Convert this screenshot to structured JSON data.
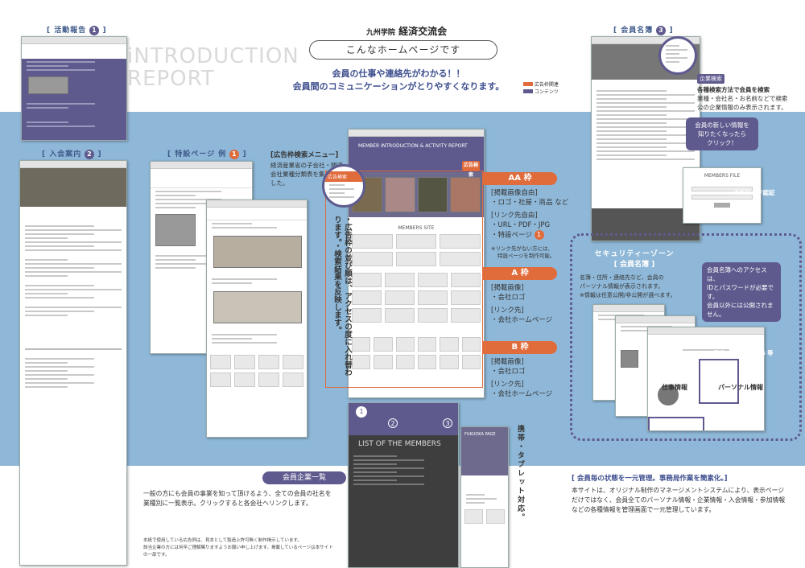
{
  "header": {
    "kicker": "九州学院",
    "title": "経済交流会",
    "pill": "こんなホームページです",
    "lead1": "会員の仕事や連絡先がわかる！！",
    "lead2": "会員間のコミュニケーションがとりやすくなります。",
    "legend": [
      {
        "label": "広告枠関連",
        "color": "#e06b3b"
      },
      {
        "label": "コンテンツ",
        "color": "#5e5a8e"
      }
    ]
  },
  "watermark": {
    "line1": "iNTRODUCTION",
    "line2": "REPORT"
  },
  "sections": {
    "activity": {
      "label": "[ 活動報告",
      "num": "1",
      "close": "]"
    },
    "join": {
      "label": "[ 入会案内",
      "num": "2",
      "close": "]"
    },
    "special": {
      "label": "[ 特設ページ 例",
      "num": "1",
      "close": "]"
    },
    "members": {
      "label": "[ 会員名簿",
      "num": "3",
      "close": "]"
    },
    "adsearch": {
      "title": "[広告枠検索メニュー]",
      "desc": "経済産業省の子会社・関連会社業種分類表を集約しました。"
    }
  },
  "center": {
    "hero": "MEMBER INTRODUCTION & ACTIVITY REPORT",
    "adtab": "広告検索",
    "membersLabel": "MEMBERS SITE",
    "vertical": "・広告枠の並び順は、アクセスの度に入れ替わります。・検索結果を反映します。",
    "listTitle": "LIST OF THE MEMBERS",
    "fukuoka": "FUKUOKA PAGE",
    "arrow": "2",
    "arrow3": "3",
    "arrow1": "1"
  },
  "ads": {
    "aa": {
      "label": "AA 枠",
      "l1": "[掲載画像自由]",
      "l2": "・ロゴ・社屋・商品 など",
      "l3": "[リンク先自由]",
      "l4": "・URL・PDF・JPG",
      "l5": "・特設ページ",
      "l5num": "1",
      "note1": "※リンク先がない方には、",
      "note2": "特設ページを制作可能。"
    },
    "a": {
      "label": "A 枠",
      "l1": "[掲載画像]",
      "l2": "・会社ロゴ",
      "l3": "[リンク先]",
      "l4": "・会社ホームページ"
    },
    "b": {
      "label": "B 枠",
      "l1": "[掲載画像]",
      "l2": "・会社ロゴ",
      "l3": "[リンク先]",
      "l4": "・会社ホームページ"
    }
  },
  "search": {
    "title": "企業検索",
    "l1": "各種検索方法で会員を検索",
    "l2": "業種・会社名・お名前などで検索",
    "l3": "公の企業情報のみ表示されます。"
  },
  "login": {
    "c1": "会員の新しい情報を",
    "c2": "知りたくなったら",
    "c3": "クリック！",
    "file": "MEMBERS FILE",
    "pw": "パスワード認証"
  },
  "security": {
    "title": "セキュリティーゾーン",
    "sub": "[ 会員名簿 ]",
    "d1": "名簿・住所・連絡先など、会員の",
    "d2": "パーソナル情報が表示されます。",
    "d3": "※情報は任意公開/非公開が選べます。",
    "access1": "会員名簿へのアクセスは、",
    "access2": "IDとパスワードが必要です。",
    "access3": "会員以外には公開されません。",
    "quick1": "クイックアクセス",
    "quick2": "電話・メール・SNS 等",
    "biz": "仕事情報",
    "personal": "パーソナル情報"
  },
  "mobile": "携帯・タブレット対応。",
  "bottom": {
    "pill": "会員企業一覧",
    "p1": "一般の方にも会員の事業を知って頂けるよう、全ての会員の社名を",
    "p2": "業種別に一覧表示。クリックすると各会社ヘリンクします。",
    "s1": "本紙で使用している広告例は、見本として製造上許可無く制作掲示しています。",
    "s2": "該当企業の方には何卒ご理解賜りますようお願い申し上げます。掲載しているページは本サイトの一部です。",
    "right_title": "[ 会員毎の状態を一元管理。事務局作業を簡素化。]",
    "r1": "本サイトは、オリジナル制作のマネージメントシステムにより、表示ページ",
    "r2": "だけではなく、会員全てのパーソナル情報・企業情報・入会情報・参加情報",
    "r3": "などの各種情報を管理画面で一元管理しています。"
  }
}
